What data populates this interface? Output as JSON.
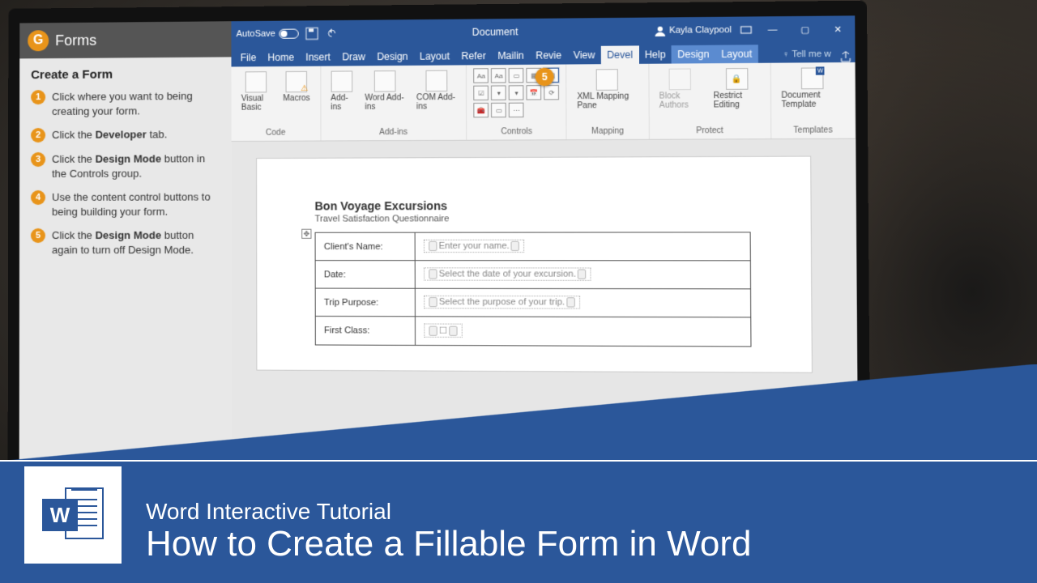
{
  "sidebar": {
    "header": "Forms",
    "title": "Create a Form",
    "steps": [
      "Click where you want to being creating your form.",
      "Click the Developer tab.",
      "Click the Design Mode button in the Controls group.",
      "Use the content control buttons to being building your form.",
      "Click the Design Mode button again to turn off Design Mode."
    ]
  },
  "word": {
    "titlebar": {
      "autosave": "AutoSave",
      "doc_title": "Document",
      "user": "Kayla Claypool"
    },
    "tabs": [
      "File",
      "Home",
      "Insert",
      "Draw",
      "Design",
      "Layout",
      "Refer",
      "Mailin",
      "Revie",
      "View",
      "Devel",
      "Help",
      "Design",
      "Layout"
    ],
    "active_tab_index": 10,
    "tellme": "Tell me w",
    "ribbon": {
      "groups": [
        {
          "label": "Code",
          "items": [
            "Visual Basic",
            "Macros"
          ]
        },
        {
          "label": "Add-ins",
          "items": [
            "Add-ins",
            "Word Add-ins",
            "COM Add-ins"
          ]
        },
        {
          "label": "Controls"
        },
        {
          "label": "Mapping",
          "items": [
            "XML Mapping Pane"
          ]
        },
        {
          "label": "Protect",
          "items": [
            "Block Authors",
            "Restrict Editing"
          ]
        },
        {
          "label": "Templates",
          "items": [
            "Document Template"
          ]
        }
      ]
    },
    "callout_5": "5",
    "doc": {
      "title": "Bon Voyage Excursions",
      "subtitle": "Travel Satisfaction Questionnaire",
      "rows": [
        {
          "label": "Client's Name:",
          "ph": "Enter your name."
        },
        {
          "label": "Date:",
          "ph": "Select the date of your excursion."
        },
        {
          "label": "Trip Purpose:",
          "ph": "Select the purpose of your trip."
        },
        {
          "label": "First Class:",
          "ph": "☐"
        }
      ]
    }
  },
  "banner": {
    "line1": "Word Interactive Tutorial",
    "line2": "How to Create a Fillable Form in Word",
    "icon_letter": "W"
  }
}
